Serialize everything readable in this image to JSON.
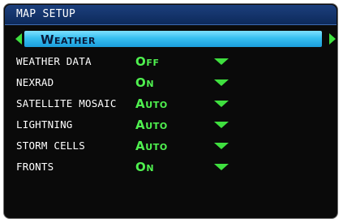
{
  "title": "MAP SETUP",
  "selector": {
    "value": "Weather"
  },
  "rows": [
    {
      "label": "WEATHER DATA",
      "value": "Off"
    },
    {
      "label": "NEXRAD",
      "value": "On"
    },
    {
      "label": "SATELLITE MOSAIC",
      "value": "Auto"
    },
    {
      "label": "LIGHTNING",
      "value": "Auto"
    },
    {
      "label": "STORM CELLS",
      "value": "Auto"
    },
    {
      "label": "FRONTS",
      "value": "On"
    }
  ],
  "colors": {
    "background": "#0a0a0a",
    "title_bar": "#1c3f7c",
    "selector_field": "#37bff0",
    "value_text": "#4ff04f",
    "label_text": "#ffffff",
    "arrow": "#3fe03f"
  }
}
